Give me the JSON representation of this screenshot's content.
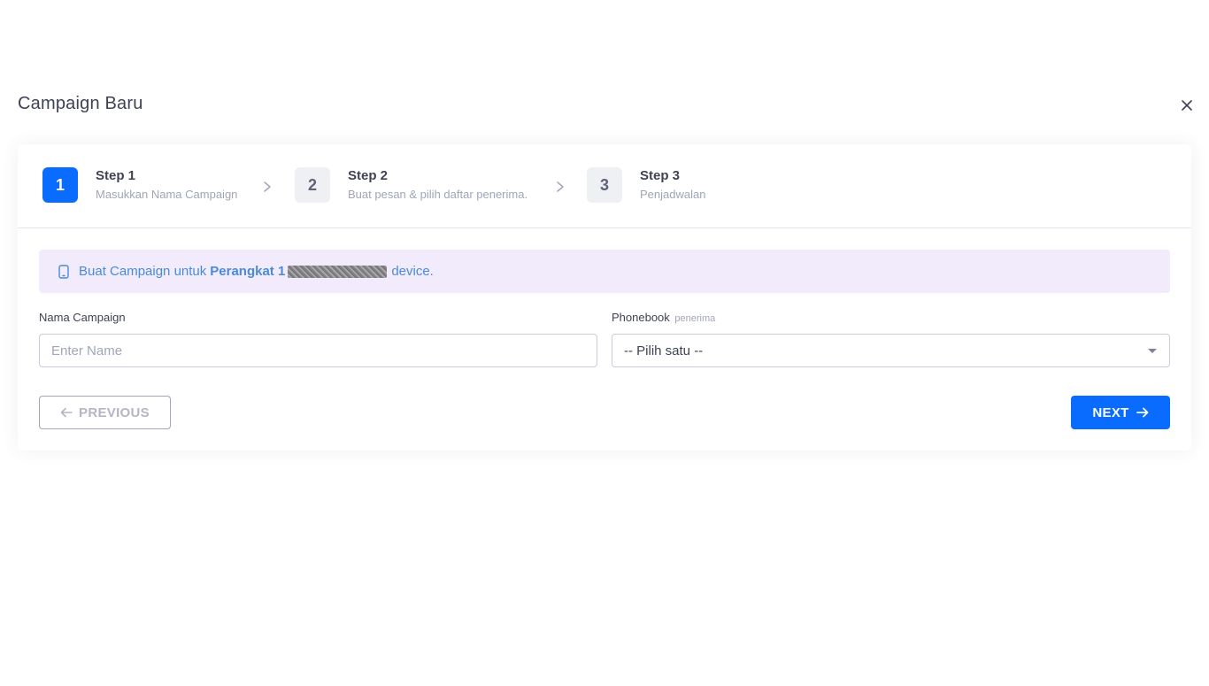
{
  "modal": {
    "title": "Campaign Baru"
  },
  "steps": [
    {
      "number": "1",
      "title": "Step 1",
      "subtitle": "Masukkan Nama Campaign",
      "active": true
    },
    {
      "number": "2",
      "title": "Step 2",
      "subtitle": "Buat pesan & pilih daftar penerima.",
      "active": false
    },
    {
      "number": "3",
      "title": "Step 3",
      "subtitle": "Penjadwalan",
      "active": false
    }
  ],
  "alert": {
    "prefix": "Buat Campaign untuk",
    "device_name": "Perangkat 1",
    "suffix": "device.",
    "icon": "phone-icon"
  },
  "form": {
    "name_label": "Nama Campaign",
    "name_placeholder": "Enter Name",
    "name_value": "",
    "phonebook_label": "Phonebook",
    "phonebook_hint": "penerima",
    "phonebook_selected": "-- Pilih satu --"
  },
  "buttons": {
    "previous_label": "PREVIOUS",
    "next_label": "NEXT"
  },
  "colors": {
    "primary": "#0a6cff",
    "alert_bg": "#f1ebfc",
    "alert_text": "#4a8bd9"
  }
}
